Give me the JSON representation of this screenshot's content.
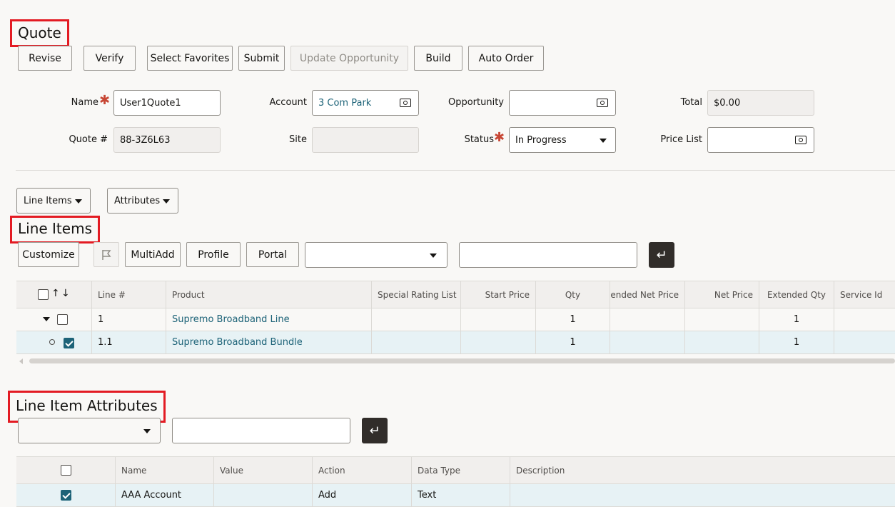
{
  "quote": {
    "title": "Quote",
    "buttons": [
      "Revise",
      "Verify",
      "Select Favorites",
      "Submit",
      "Update Opportunity",
      "Build",
      "Auto Order"
    ],
    "form": {
      "name_label": "Name",
      "name_value": "User1Quote1",
      "quote_num_label": "Quote #",
      "quote_num_value": "88-3Z6L63",
      "account_label": "Account",
      "account_value": "3 Com Park",
      "site_label": "Site",
      "site_value": "",
      "opportunity_label": "Opportunity",
      "opportunity_value": "",
      "status_label": "Status",
      "status_value": "In Progress",
      "total_label": "Total",
      "total_value": "$0.00",
      "price_list_label": "Price List",
      "price_list_value": ""
    }
  },
  "view_tabs": {
    "line_items": "Line Items",
    "attributes": "Attributes"
  },
  "line_items": {
    "title": "Line Items",
    "buttons": {
      "customize": "Customize",
      "multiadd": "MultiAdd",
      "profile": "Profile",
      "portal": "Portal"
    },
    "query_select": "",
    "query_input": "",
    "columns": [
      "Line #",
      "Product",
      "Special Rating List",
      "Start Price",
      "Qty",
      "ended Net Price",
      "Net Price",
      "Extended Qty",
      "Service Id"
    ],
    "rows": [
      {
        "line": "1",
        "product": "Supremo Broadband Line",
        "qty": "1",
        "ext_qty": "1",
        "checked": false
      },
      {
        "line": "1.1",
        "product": "Supremo Broadband Bundle",
        "qty": "1",
        "ext_qty": "1",
        "checked": true
      }
    ]
  },
  "attributes": {
    "title": "Line Item Attributes",
    "query_select": "",
    "query_input": "",
    "columns": [
      "Name",
      "Value",
      "Action",
      "Data Type",
      "Description"
    ],
    "rows": [
      {
        "name": "AAA Account",
        "value": "",
        "action": "Add",
        "data_type": "Text",
        "description": "",
        "checked": true
      }
    ]
  },
  "colors": {
    "accent": "#1d6378",
    "required": "#c74634",
    "highlight": "#e31b23",
    "row_selected": "#e7f2f5"
  }
}
